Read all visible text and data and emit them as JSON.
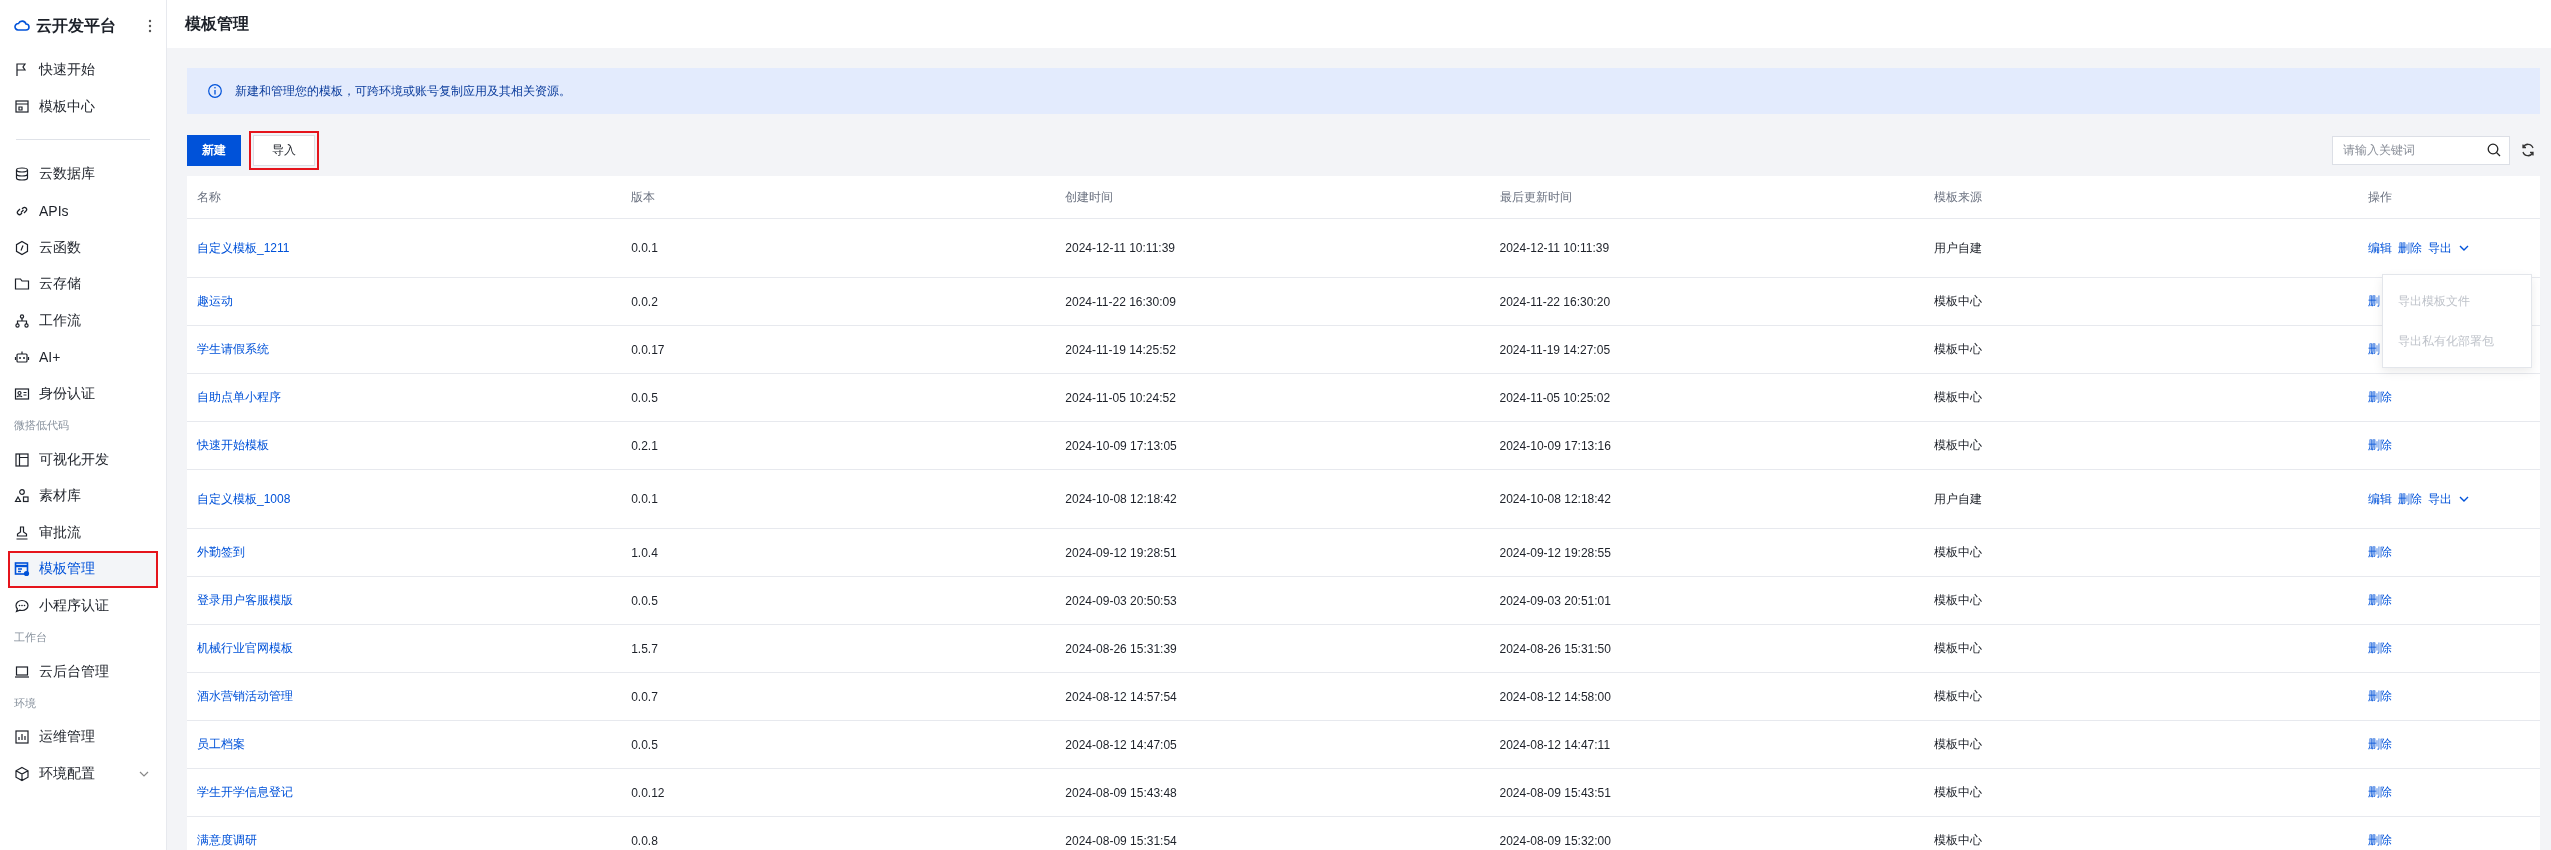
{
  "sidebar": {
    "brand": "云开发平台",
    "sections": [
      {
        "items": [
          {
            "label": "快速开始",
            "selected": false,
            "highlighted": false
          },
          {
            "label": "模板中心",
            "selected": false,
            "highlighted": false
          }
        ]
      },
      {
        "items": [
          {
            "label": "云数据库",
            "selected": false,
            "highlighted": false
          },
          {
            "label": "APIs",
            "selected": false,
            "highlighted": false
          },
          {
            "label": "云函数",
            "selected": false,
            "highlighted": false
          },
          {
            "label": "云存储",
            "selected": false,
            "highlighted": false
          },
          {
            "label": "工作流",
            "selected": false,
            "highlighted": false
          },
          {
            "label": "AI+",
            "selected": false,
            "highlighted": false
          },
          {
            "label": "身份认证",
            "selected": false,
            "highlighted": false
          }
        ]
      },
      {
        "heading": "微搭低代码",
        "items": [
          {
            "label": "可视化开发",
            "selected": false,
            "highlighted": false
          },
          {
            "label": "素材库",
            "selected": false,
            "highlighted": false
          },
          {
            "label": "审批流",
            "selected": false,
            "highlighted": false
          },
          {
            "label": "模板管理",
            "selected": true,
            "highlighted": true
          },
          {
            "label": "小程序认证",
            "selected": false,
            "highlighted": false
          }
        ]
      },
      {
        "heading": "工作台",
        "items": [
          {
            "label": "云后台管理",
            "selected": false,
            "highlighted": false
          }
        ]
      },
      {
        "heading": "环境",
        "items": [
          {
            "label": "运维管理",
            "selected": false,
            "highlighted": false
          },
          {
            "label": "环境配置",
            "selected": false,
            "highlighted": false,
            "expanded": false
          }
        ]
      }
    ]
  },
  "page": {
    "title": "模板管理"
  },
  "notice": "新建和管理您的模板，可跨环境或账号复制应用及其相关资源。",
  "toolbar": {
    "buttons": [
      {
        "label": "新建",
        "kind": "primary",
        "highlighted": false
      },
      {
        "label": "导入",
        "kind": "default",
        "highlighted": true
      }
    ],
    "search": {
      "placeholder": "请输入关键词"
    }
  },
  "table": {
    "columns": [
      "名称",
      "版本",
      "创建时间",
      "最后更新时间",
      "模板来源",
      "操作"
    ],
    "rows": [
      {
        "name": "自定义模板_1211",
        "version": "0.0.1",
        "created": "2024-12-11 10:11:39",
        "updated": "2024-12-11 10:11:39",
        "source": "用户自建",
        "actions": [
          {
            "label": "编辑",
            "kind": "link"
          },
          {
            "label": "删除",
            "kind": "link"
          },
          {
            "label": "导出",
            "kind": "dropdown",
            "expanded": true,
            "menu": [
              {
                "label": "导出模板文件",
                "disabled": true
              },
              {
                "label": "导出私有化部署包",
                "disabled": true
              }
            ]
          }
        ]
      },
      {
        "name": "趣运动",
        "version": "0.0.2",
        "created": "2024-11-22 16:30:09",
        "updated": "2024-11-22 16:30:20",
        "source": "模板中心",
        "actions": [
          {
            "label": "删",
            "kind": "link"
          }
        ]
      },
      {
        "name": "学生请假系统",
        "version": "0.0.17",
        "created": "2024-11-19 14:25:52",
        "updated": "2024-11-19 14:27:05",
        "source": "模板中心",
        "actions": [
          {
            "label": "删",
            "kind": "link"
          }
        ]
      },
      {
        "name": "自助点单小程序",
        "version": "0.0.5",
        "created": "2024-11-05 10:24:52",
        "updated": "2024-11-05 10:25:02",
        "source": "模板中心",
        "actions": [
          {
            "label": "删除",
            "kind": "link"
          }
        ]
      },
      {
        "name": "快速开始模板",
        "version": "0.2.1",
        "created": "2024-10-09 17:13:05",
        "updated": "2024-10-09 17:13:16",
        "source": "模板中心",
        "actions": [
          {
            "label": "删除",
            "kind": "link"
          }
        ]
      },
      {
        "name": "自定义模板_1008",
        "version": "0.0.1",
        "created": "2024-10-08 12:18:42",
        "updated": "2024-10-08 12:18:42",
        "source": "用户自建",
        "actions": [
          {
            "label": "编辑",
            "kind": "link"
          },
          {
            "label": "删除",
            "kind": "link"
          },
          {
            "label": "导出",
            "kind": "dropdown"
          }
        ]
      },
      {
        "name": "外勤签到",
        "version": "1.0.4",
        "created": "2024-09-12 19:28:51",
        "updated": "2024-09-12 19:28:55",
        "source": "模板中心",
        "actions": [
          {
            "label": "删除",
            "kind": "link"
          }
        ]
      },
      {
        "name": "登录用户客服模版",
        "version": "0.0.5",
        "created": "2024-09-03 20:50:53",
        "updated": "2024-09-03 20:51:01",
        "source": "模板中心",
        "actions": [
          {
            "label": "删除",
            "kind": "link"
          }
        ]
      },
      {
        "name": "机械行业官网模板",
        "version": "1.5.7",
        "created": "2024-08-26 15:31:39",
        "updated": "2024-08-26 15:31:50",
        "source": "模板中心",
        "actions": [
          {
            "label": "删除",
            "kind": "link"
          }
        ]
      },
      {
        "name": "酒水营销活动管理",
        "version": "0.0.7",
        "created": "2024-08-12 14:57:54",
        "updated": "2024-08-12 14:58:00",
        "source": "模板中心",
        "actions": [
          {
            "label": "删除",
            "kind": "link"
          }
        ]
      },
      {
        "name": "员工档案",
        "version": "0.0.5",
        "created": "2024-08-12 14:47:05",
        "updated": "2024-08-12 14:47:11",
        "source": "模板中心",
        "actions": [
          {
            "label": "删除",
            "kind": "link"
          }
        ]
      },
      {
        "name": "学生开学信息登记",
        "version": "0.0.12",
        "created": "2024-08-09 15:43:48",
        "updated": "2024-08-09 15:43:51",
        "source": "模板中心",
        "actions": [
          {
            "label": "删除",
            "kind": "link"
          }
        ]
      },
      {
        "name": "满意度调研",
        "version": "0.0.8",
        "created": "2024-08-09 15:31:54",
        "updated": "2024-08-09 15:32:00",
        "source": "模板中心",
        "actions": [
          {
            "label": "删除",
            "kind": "link"
          }
        ]
      }
    ]
  }
}
